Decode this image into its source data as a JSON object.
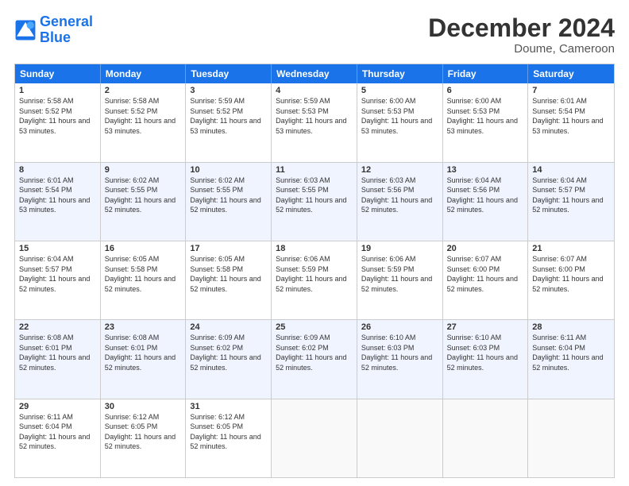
{
  "logo": {
    "line1": "General",
    "line2": "Blue"
  },
  "title": "December 2024",
  "subtitle": "Doume, Cameroon",
  "days": [
    "Sunday",
    "Monday",
    "Tuesday",
    "Wednesday",
    "Thursday",
    "Friday",
    "Saturday"
  ],
  "weeks": [
    [
      {
        "day": 1,
        "sunrise": "5:58 AM",
        "sunset": "5:52 PM",
        "daylight": "11 hours and 53 minutes"
      },
      {
        "day": 2,
        "sunrise": "5:58 AM",
        "sunset": "5:52 PM",
        "daylight": "11 hours and 53 minutes"
      },
      {
        "day": 3,
        "sunrise": "5:59 AM",
        "sunset": "5:52 PM",
        "daylight": "11 hours and 53 minutes"
      },
      {
        "day": 4,
        "sunrise": "5:59 AM",
        "sunset": "5:53 PM",
        "daylight": "11 hours and 53 minutes"
      },
      {
        "day": 5,
        "sunrise": "6:00 AM",
        "sunset": "5:53 PM",
        "daylight": "11 hours and 53 minutes"
      },
      {
        "day": 6,
        "sunrise": "6:00 AM",
        "sunset": "5:53 PM",
        "daylight": "11 hours and 53 minutes"
      },
      {
        "day": 7,
        "sunrise": "6:01 AM",
        "sunset": "5:54 PM",
        "daylight": "11 hours and 53 minutes"
      }
    ],
    [
      {
        "day": 8,
        "sunrise": "6:01 AM",
        "sunset": "5:54 PM",
        "daylight": "11 hours and 53 minutes"
      },
      {
        "day": 9,
        "sunrise": "6:02 AM",
        "sunset": "5:55 PM",
        "daylight": "11 hours and 52 minutes"
      },
      {
        "day": 10,
        "sunrise": "6:02 AM",
        "sunset": "5:55 PM",
        "daylight": "11 hours and 52 minutes"
      },
      {
        "day": 11,
        "sunrise": "6:03 AM",
        "sunset": "5:55 PM",
        "daylight": "11 hours and 52 minutes"
      },
      {
        "day": 12,
        "sunrise": "6:03 AM",
        "sunset": "5:56 PM",
        "daylight": "11 hours and 52 minutes"
      },
      {
        "day": 13,
        "sunrise": "6:04 AM",
        "sunset": "5:56 PM",
        "daylight": "11 hours and 52 minutes"
      },
      {
        "day": 14,
        "sunrise": "6:04 AM",
        "sunset": "5:57 PM",
        "daylight": "11 hours and 52 minutes"
      }
    ],
    [
      {
        "day": 15,
        "sunrise": "6:04 AM",
        "sunset": "5:57 PM",
        "daylight": "11 hours and 52 minutes"
      },
      {
        "day": 16,
        "sunrise": "6:05 AM",
        "sunset": "5:58 PM",
        "daylight": "11 hours and 52 minutes"
      },
      {
        "day": 17,
        "sunrise": "6:05 AM",
        "sunset": "5:58 PM",
        "daylight": "11 hours and 52 minutes"
      },
      {
        "day": 18,
        "sunrise": "6:06 AM",
        "sunset": "5:59 PM",
        "daylight": "11 hours and 52 minutes"
      },
      {
        "day": 19,
        "sunrise": "6:06 AM",
        "sunset": "5:59 PM",
        "daylight": "11 hours and 52 minutes"
      },
      {
        "day": 20,
        "sunrise": "6:07 AM",
        "sunset": "6:00 PM",
        "daylight": "11 hours and 52 minutes"
      },
      {
        "day": 21,
        "sunrise": "6:07 AM",
        "sunset": "6:00 PM",
        "daylight": "11 hours and 52 minutes"
      }
    ],
    [
      {
        "day": 22,
        "sunrise": "6:08 AM",
        "sunset": "6:01 PM",
        "daylight": "11 hours and 52 minutes"
      },
      {
        "day": 23,
        "sunrise": "6:08 AM",
        "sunset": "6:01 PM",
        "daylight": "11 hours and 52 minutes"
      },
      {
        "day": 24,
        "sunrise": "6:09 AM",
        "sunset": "6:02 PM",
        "daylight": "11 hours and 52 minutes"
      },
      {
        "day": 25,
        "sunrise": "6:09 AM",
        "sunset": "6:02 PM",
        "daylight": "11 hours and 52 minutes"
      },
      {
        "day": 26,
        "sunrise": "6:10 AM",
        "sunset": "6:03 PM",
        "daylight": "11 hours and 52 minutes"
      },
      {
        "day": 27,
        "sunrise": "6:10 AM",
        "sunset": "6:03 PM",
        "daylight": "11 hours and 52 minutes"
      },
      {
        "day": 28,
        "sunrise": "6:11 AM",
        "sunset": "6:04 PM",
        "daylight": "11 hours and 52 minutes"
      }
    ],
    [
      {
        "day": 29,
        "sunrise": "6:11 AM",
        "sunset": "6:04 PM",
        "daylight": "11 hours and 52 minutes"
      },
      {
        "day": 30,
        "sunrise": "6:12 AM",
        "sunset": "6:05 PM",
        "daylight": "11 hours and 52 minutes"
      },
      {
        "day": 31,
        "sunrise": "6:12 AM",
        "sunset": "6:05 PM",
        "daylight": "11 hours and 52 minutes"
      },
      null,
      null,
      null,
      null
    ]
  ]
}
